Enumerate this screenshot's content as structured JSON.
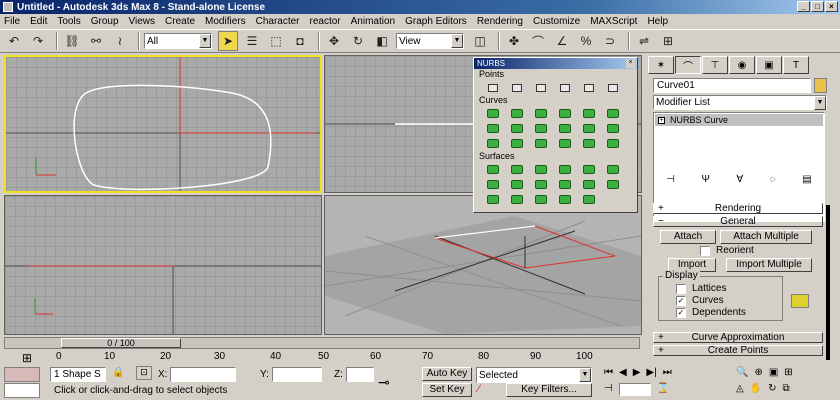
{
  "title": "Untitled - Autodesk 3ds Max 8 - Stand-alone License",
  "menu": [
    "File",
    "Edit",
    "Tools",
    "Group",
    "Views",
    "Create",
    "Modifiers",
    "Character",
    "reactor",
    "Animation",
    "Graph Editors",
    "Rendering",
    "Customize",
    "MAXScript",
    "Help"
  ],
  "toolbar": {
    "selection_filter": "All",
    "ref_coord": "View"
  },
  "nurbs": {
    "title": "NURBS",
    "sections": [
      "Points",
      "Curves",
      "Surfaces"
    ]
  },
  "panel": {
    "object_name": "Curve01",
    "modifier_list": "Modifier List",
    "stack_item": "NURBS Curve",
    "rollups": {
      "rendering": "Rendering",
      "general": "General",
      "curve_approx": "Curve Approximation",
      "create_points": "Create Points"
    },
    "buttons": {
      "attach": "Attach",
      "attach_multiple": "Attach Multiple",
      "import": "Import",
      "import_multiple": "Import Multiple"
    },
    "reorient": "Reorient",
    "display_label": "Display",
    "display": {
      "lattices": "Lattices",
      "curves": "Curves",
      "dependents": "Dependents"
    }
  },
  "timeline": {
    "frame": "0 / 100",
    "ticks": [
      "0",
      "10",
      "20",
      "30",
      "40",
      "50",
      "60",
      "70",
      "80",
      "90",
      "100"
    ]
  },
  "status": {
    "selection": "1 Shape S",
    "x_label": "X:",
    "y_label": "Y:",
    "z_label": "Z:",
    "prompt": "Click or click-and-drag to select objects",
    "auto_key": "Auto Key",
    "set_key": "Set Key",
    "selected": "Selected",
    "key_filters": "Key Filters..."
  }
}
